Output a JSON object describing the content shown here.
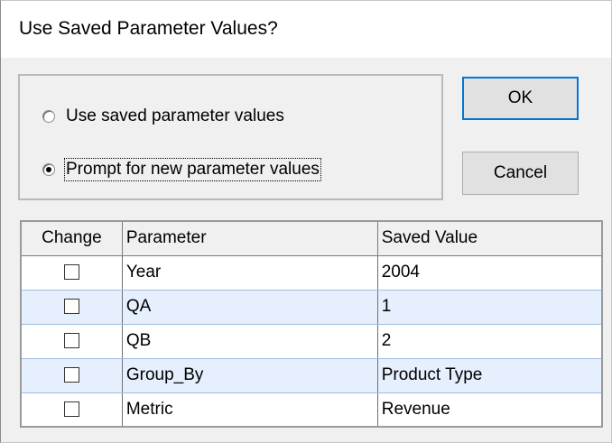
{
  "window": {
    "title": "Use Saved Parameter Values?"
  },
  "options": {
    "use_saved_label": "Use saved parameter values",
    "prompt_new_label": "Prompt for new parameter values",
    "selected": "prompt_new"
  },
  "buttons": {
    "ok_label": "OK",
    "cancel_label": "Cancel"
  },
  "grid": {
    "columns": [
      "Change",
      "Parameter",
      "Saved Value"
    ],
    "rows": [
      {
        "change": false,
        "parameter": "Year",
        "saved_value": "2004"
      },
      {
        "change": false,
        "parameter": "QA",
        "saved_value": "1"
      },
      {
        "change": false,
        "parameter": "QB",
        "saved_value": "2"
      },
      {
        "change": false,
        "parameter": "Group_By",
        "saved_value": "Product Type"
      },
      {
        "change": false,
        "parameter": "Metric",
        "saved_value": "Revenue"
      }
    ]
  },
  "colors": {
    "dialog_bg": "#f0f0f0",
    "title_bg": "#ffffff",
    "default_button_border": "#0078d7",
    "alt_row_bg": "#e5effd"
  }
}
